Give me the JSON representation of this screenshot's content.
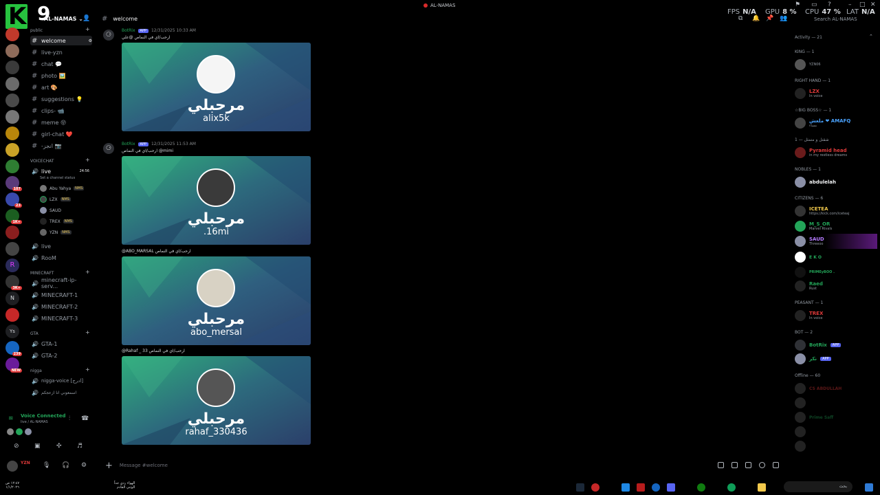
{
  "window": {
    "title": "AL-NAMAS"
  },
  "hud": {
    "fps_label": "FPS",
    "fps_value": "N/A",
    "gpu_label": "GPU",
    "gpu_value": "8 %",
    "cpu_label": "CPU",
    "cpu_value": "47 %",
    "lat_label": "LAT",
    "lat_value": "N/A"
  },
  "logo": {
    "letter": "K",
    "digit": "9"
  },
  "server": {
    "name": "AL-NAMAS"
  },
  "server_badges": [
    "107",
    "23",
    "1K+",
    "3K+",
    "3K+",
    "239",
    "3K+",
    "NEW"
  ],
  "server_letters": [
    "R",
    "N",
    "Ys"
  ],
  "categories": {
    "public": "public",
    "voicechat": "VOICECHAT",
    "minecraft": "MINECRAFT",
    "gta": "GTA",
    "nigga": "nigga"
  },
  "channels_public": [
    "welcome",
    "live-yzn",
    "chat 💬",
    "photo 🖼️",
    "art 🎨",
    "suggestions 💡",
    "clips- 📹",
    "meme 😝",
    "girl-chat ❤️",
    "-انجز 📷"
  ],
  "voice_live": {
    "name": "live",
    "time": "24:56",
    "status": "Set a channel status"
  },
  "voice_users": [
    {
      "name": "Abu Yahya",
      "tag": "NMS"
    },
    {
      "name": "LZX",
      "tag": "NMS"
    },
    {
      "name": "SAUD",
      "tag": ""
    },
    {
      "name": "TREX",
      "tag": "NMS"
    },
    {
      "name": "YZN",
      "tag": "NMS"
    }
  ],
  "voice_channels": [
    "live",
    "RooM"
  ],
  "minecraft_channels": [
    "minecraft-ip-serv...",
    "MINECRAFT-1",
    "MINECRAFT-2",
    "MINECRAFT-3"
  ],
  "gta_channels": [
    "GTA-1",
    "GTA-2"
  ],
  "nigga_channels": [
    "nigga-voice [ادرج]",
    "اسمعوني انا ازعجكم"
  ],
  "chat": {
    "channel": "welcome",
    "messages": [
      {
        "bot": "BotRix",
        "app": "APP",
        "time": "12/31/2025 10:33 AM",
        "text": "ارحب/اي في النماص @علي",
        "title": "مرحبلي",
        "user": "alix5k"
      },
      {
        "bot": "BotRix",
        "app": "APP",
        "time": "12/31/2025 11:53 AM",
        "text": "ارحب/اي في النماص @mimi",
        "title": "مرحبلي",
        "user": ".16mi"
      },
      {
        "bot": "",
        "app": "",
        "time": "",
        "text": "@ABO_MARSAL ارحب/اي في النماص",
        "title": "مرحبلي",
        "user": "abo_mersal"
      },
      {
        "bot": "",
        "app": "",
        "time": "",
        "text": "@Rahaf _ 33 ارحب/اي في النماص",
        "title": "مرحبلي",
        "user": "rahaf_330436"
      }
    ],
    "composer_placeholder": "Message #welcome"
  },
  "search": {
    "placeholder": "Search AL-NAMAS"
  },
  "members": {
    "activity": "Activity — 21",
    "groups": [
      {
        "head": "KING — 1",
        "items": [
          {
            "name": "",
            "status": "YZN06",
            "color": "#e03a3a"
          }
        ]
      },
      {
        "head": "RIGHT HAND — 1",
        "items": [
          {
            "name": "LZX",
            "status": "In voice",
            "color": "#e03a3a"
          }
        ]
      },
      {
        "head": "☆BIG BOSS☆ — 1",
        "items": [
          {
            "name": "ملعش ❤ AMAFQ",
            "status": "مساء",
            "color": "#4aa3ff"
          }
        ]
      },
      {
        "head": "شقتل و متمثل — 1",
        "items": [
          {
            "name": "Pyramid head",
            "status": "in my restless dreams",
            "color": "#e03a3a"
          }
        ]
      },
      {
        "head": "NOBLES — 1",
        "items": [
          {
            "name": "abdulelah",
            "status": "",
            "color": "#f2f3f5"
          }
        ]
      },
      {
        "head": "CITIZENS — 6",
        "items": [
          {
            "name": "ICETEA",
            "status": "https://kick.com/iceteaj",
            "color": "#f2c94c"
          },
          {
            "name": "M_S_OR",
            "status": "Marvel Rivals",
            "color": "#23a559"
          },
          {
            "name": "SAUD",
            "status": "Threeoo",
            "color": "#b57bff"
          },
          {
            "name": "E K O",
            "status": "",
            "color": "#23a559"
          },
          {
            "name": "PRIMEyBOO .",
            "status": "",
            "color": "#23a559"
          },
          {
            "name": "Raed",
            "status": "Rust",
            "color": "#23a559"
          }
        ]
      },
      {
        "head": "PEASANT — 1",
        "items": [
          {
            "name": "TREX",
            "status": "In voice",
            "color": "#e03a3a"
          }
        ]
      },
      {
        "head": "BOT — 2",
        "items": [
          {
            "name": "BotRix",
            "status": "",
            "color": "#23a559"
          },
          {
            "name": "نكر",
            "status": "",
            "color": "#23a559"
          }
        ]
      },
      {
        "head": "Offline — 60",
        "items": [
          {
            "name": "CS ABDULLAH",
            "status": "",
            "color": "#555"
          },
          {
            "name": "",
            "status": "",
            "color": "#555"
          },
          {
            "name": "Prime Saff",
            "status": "",
            "color": "#555"
          },
          {
            "name": "",
            "status": "",
            "color": "#555"
          },
          {
            "name": "",
            "status": "",
            "color": "#555"
          }
        ]
      }
    ]
  },
  "voice_panel": {
    "connected": "Voice Connected",
    "sub": "live / AL-NAMAS"
  },
  "user_panel": {
    "name": "YZN"
  },
  "taskbar": {
    "clock": "١٢:٤٧ ص",
    "date": "١/١/٢٠٢٦",
    "news": "الهواء ردي جداً",
    "news_sub": "الوثني القادم",
    "search": "بحث"
  }
}
